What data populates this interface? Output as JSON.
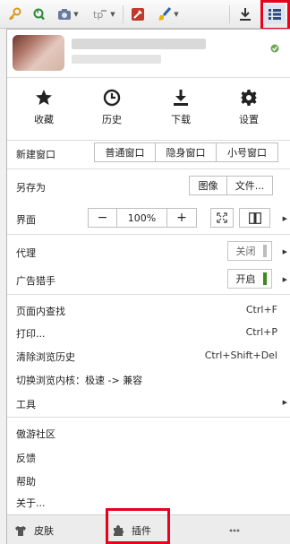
{
  "quick_actions": [
    {
      "label": "收藏",
      "icon": "star-icon"
    },
    {
      "label": "历史",
      "icon": "clock-icon"
    },
    {
      "label": "下载",
      "icon": "download-icon"
    },
    {
      "label": "设置",
      "icon": "gear-icon"
    }
  ],
  "new_window": {
    "label": "新建窗口",
    "options": [
      "普通窗口",
      "隐身窗口",
      "小号窗口"
    ]
  },
  "save_as": {
    "label": "另存为",
    "options": [
      "图像",
      "文件..."
    ]
  },
  "interface": {
    "label": "界面",
    "zoom_out": "−",
    "zoom": "100%",
    "zoom_in": "+"
  },
  "proxy": {
    "label": "代理",
    "state": "关闭"
  },
  "ad_blocker": {
    "label": "广告猎手",
    "state": "开启"
  },
  "items": [
    {
      "label": "页面内查找",
      "shortcut": "Ctrl+F"
    },
    {
      "label": "打印...",
      "shortcut": "Ctrl+P"
    },
    {
      "label": "清除浏览历史",
      "shortcut": "Ctrl+Shift+Del"
    },
    {
      "label": "切换浏览内核：极速 -> 兼容",
      "shortcut": ""
    }
  ],
  "tools": {
    "label": "工具"
  },
  "footer_items": [
    "傲游社区",
    "反馈",
    "帮助",
    "关于..."
  ],
  "bottom_bar": {
    "skin": "皮肤",
    "plugins": "插件"
  },
  "colors": {
    "highlight": "#e8001c",
    "toggle_off": "#bdbdbd",
    "toggle_on": "#3d8b1e"
  }
}
